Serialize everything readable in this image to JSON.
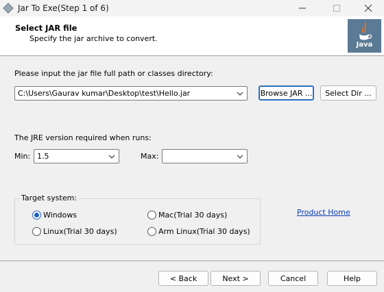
{
  "window": {
    "title": "Jar To Exe(Step 1 of 6)"
  },
  "header": {
    "title": "Select JAR file",
    "subtitle": "Specify the jar archive to convert.",
    "logo_text": "Java"
  },
  "jar": {
    "prompt": "Please input the jar file full path or classes directory:",
    "path_value": "C:\\Users\\Gaurav kumar\\Desktop\\test\\Hello.jar",
    "browse_label": "Browse JAR ...",
    "select_dir_label": "Select Dir ..."
  },
  "jre": {
    "prompt": "The JRE version required when runs:",
    "min_label": "Min:",
    "min_value": "1.5",
    "max_label": "Max:",
    "max_value": ""
  },
  "target": {
    "title": "Target system:",
    "options": [
      {
        "label": "Windows",
        "checked": true
      },
      {
        "label": "Mac(Trial 30 days)",
        "checked": false
      },
      {
        "label": "Linux(Trial 30 days)",
        "checked": false
      },
      {
        "label": "Arm Linux(Trial 30 days)",
        "checked": false
      }
    ]
  },
  "links": {
    "product_home": "Product Home"
  },
  "footer": {
    "back_label": "< Back",
    "next_label": "Next >",
    "cancel_label": "Cancel",
    "help_label": "Help"
  },
  "colors": {
    "accent": "#1f5fbf",
    "link": "#0a3bb5",
    "logo_bg": "#5b7a95"
  },
  "icons": [
    "app-icon",
    "minimize-icon",
    "maximize-icon",
    "close-icon",
    "java-logo-icon",
    "chevron-down-icon"
  ]
}
